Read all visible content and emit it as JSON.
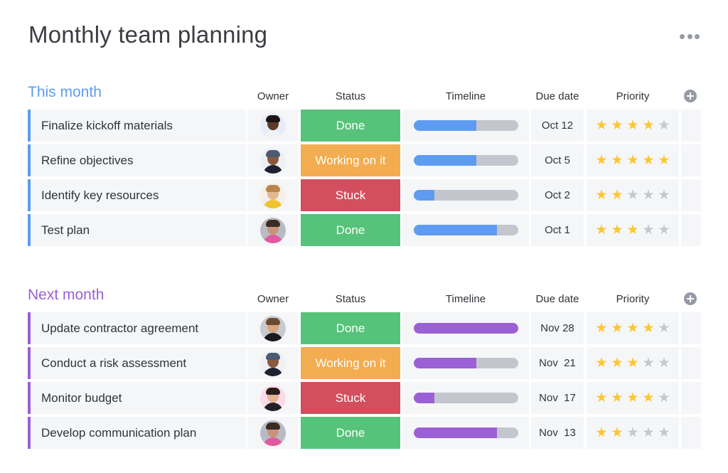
{
  "page": {
    "title": "Monthly team planning",
    "more_icon": "more-horizontal-icon"
  },
  "colors": {
    "done": "#57c27a",
    "working": "#f3ac4f",
    "stuck": "#d34e5e",
    "this_month_accent": "#5d9cf0",
    "next_month_accent": "#9b5fd6",
    "track": "#c4c6cd",
    "star_on": "#fdc62f",
    "star_off": "#c5c7d0"
  },
  "columns": {
    "owner": "Owner",
    "status": "Status",
    "timeline": "Timeline",
    "due": "Due date",
    "priority": "Priority",
    "add_icon": "plus-circle-icon"
  },
  "groups": [
    {
      "title": "This month",
      "accent": "#5d9cf0",
      "rows": [
        {
          "name": "Finalize kickoff materials",
          "owner": "woman-curly-hair-glasses",
          "status": "Done",
          "status_key": "done",
          "timeline_progress": 0.6,
          "due": "Oct 12",
          "priority": 4
        },
        {
          "name": "Refine objectives",
          "owner": "man-cap-beard",
          "status": "Working on it",
          "status_key": "working",
          "timeline_progress": 0.6,
          "due": "Oct 5",
          "priority": 5
        },
        {
          "name": "Identify key resources",
          "owner": "woman-long-blonde-hair",
          "status": "Stuck",
          "status_key": "stuck",
          "timeline_progress": 0.2,
          "due": "Oct 2",
          "priority": 2
        },
        {
          "name": "Test plan",
          "owner": "man-beard-floral-shirt",
          "status": "Done",
          "status_key": "done",
          "timeline_progress": 0.8,
          "due": "Oct 1",
          "priority": 3
        }
      ]
    },
    {
      "title": "Next month",
      "accent": "#9b5fd6",
      "rows": [
        {
          "name": "Update contractor agreement",
          "owner": "man-short-hair",
          "status": "Done",
          "status_key": "done",
          "timeline_progress": 1.0,
          "due": "Nov 28",
          "priority": 4
        },
        {
          "name": "Conduct a risk assessment",
          "owner": "man-cap-beard",
          "status": "Working on it",
          "status_key": "working",
          "timeline_progress": 0.6,
          "due": "Nov  21",
          "priority": 3
        },
        {
          "name": "Monitor budget",
          "owner": "woman-dark-hair",
          "status": "Stuck",
          "status_key": "stuck",
          "timeline_progress": 0.2,
          "due": "Nov  17",
          "priority": 4
        },
        {
          "name": "Develop communication plan",
          "owner": "man-beard-floral-shirt",
          "status": "Done",
          "status_key": "done",
          "timeline_progress": 0.8,
          "due": "Nov  13",
          "priority": 2
        }
      ]
    }
  ]
}
